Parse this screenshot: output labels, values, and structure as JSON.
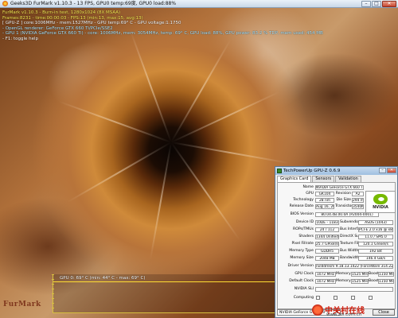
{
  "furmark": {
    "title": "Geeks3D FurMark v1.10.3 - 13 FPS, GPU0 temp:69度, GPU0 load:88%",
    "osd": {
      "line1": "FurMark v1.10.3 - Burn-in test, 1280x1024 (8X MSAA)",
      "line2": "Frames:8231 - time:00:00:03 - FPS:13 (min:13, max:15, avg:13)",
      "line3": "[ GPU-Z ] core:1006MHz - mem:1527MHz - GPU temp:69° C - GPU voltage:1.1750",
      "line4": "- OpenGL renderer: GeForce GTX 660 Ti/PCIe/SSE2",
      "line5": "- GPU 1 (NVIDIA GeForce GTX 660 Ti) - core: 1006MHz, mem: 3054MHz, temp: 69° C, GPU load: 88%, GPU power: 83.2 % TDP, mem used: 454 MB",
      "line6": "- F1: toggle help"
    },
    "graph_label": "GPU 0: 69° C (min: 44° C - max: 69° C)",
    "logo_text": "FurMark"
  },
  "gpuz": {
    "title": "TechPowerUp GPU-Z 0.6.9",
    "tabs": [
      "Graphics Card",
      "Sensors",
      "Validation"
    ],
    "fields": {
      "name_label": "Name",
      "name": "NVIDIA GeForce GTX 660 Ti",
      "gpu_label": "GPU",
      "gpu": "GK104",
      "revision_label": "Revision",
      "revision": "A2",
      "technology_label": "Technology",
      "technology": "28 nm",
      "die_size_label": "Die Size",
      "die_size": "294 mm²",
      "release_label": "Release Date",
      "release": "Aug 16, 2012",
      "transistors_label": "Transistors",
      "transistors": "3540M",
      "bios_label": "BIOS Version",
      "bios": "80.04.4B.00.0A (P2004-0001)",
      "device_label": "Device ID",
      "device": "10DE - 1183",
      "subvendor_label": "Subvendor",
      "subvendor": "ASUS (1043)",
      "rops_label": "ROPs/TMUs",
      "rops": "24 / 112",
      "bus_label": "Bus Interface",
      "bus": "PCI-E 2.0 x16 @ x8 2.0",
      "shaders_label": "Shaders",
      "shaders": "1344 Unified",
      "directx_label": "DirectX Support",
      "directx": "11.0 / SM5.0",
      "pixel_label": "Pixel Fillrate",
      "pixel": "25.7 GPixel/s",
      "texture_label": "Texture Fillrate",
      "texture": "120.1 GTexel/s",
      "memtype_label": "Memory Type",
      "memtype": "GDDR5",
      "buswidth_label": "Bus Width",
      "buswidth": "192 Bit",
      "memsize_label": "Memory Size",
      "memsize": "2048 MB",
      "bandwidth_label": "Bandwidth",
      "bandwidth": "146.4 GB/s",
      "driver_label": "Driver Version",
      "driver": "nvlddmkm 9.18.13.1422 (ForceWare 314.22) / Win7 64",
      "gpuclock_label": "GPU Clock",
      "gpuclock": "1072 MHz",
      "memory_label": "Memory",
      "memory": "1525 MHz",
      "boost_label": "Boost",
      "boost": "1150 MHz",
      "defclock_label": "Default Clock",
      "defclock": "1072 MHz",
      "defmemory_label": "Memory",
      "defmemory": "1525 MHz",
      "defboost_label": "Boost",
      "defboost": "1150 MHz",
      "sli_label": "NVIDIA SLI",
      "computing_label": "Computing"
    },
    "logo_text": "NVIDIA",
    "selected_card": "NVIDIA GeForce GTX 660 Ti",
    "close_label": "Close"
  },
  "watermark": {
    "cn": "中关村在线",
    "url": "www.zol.com.cn"
  }
}
